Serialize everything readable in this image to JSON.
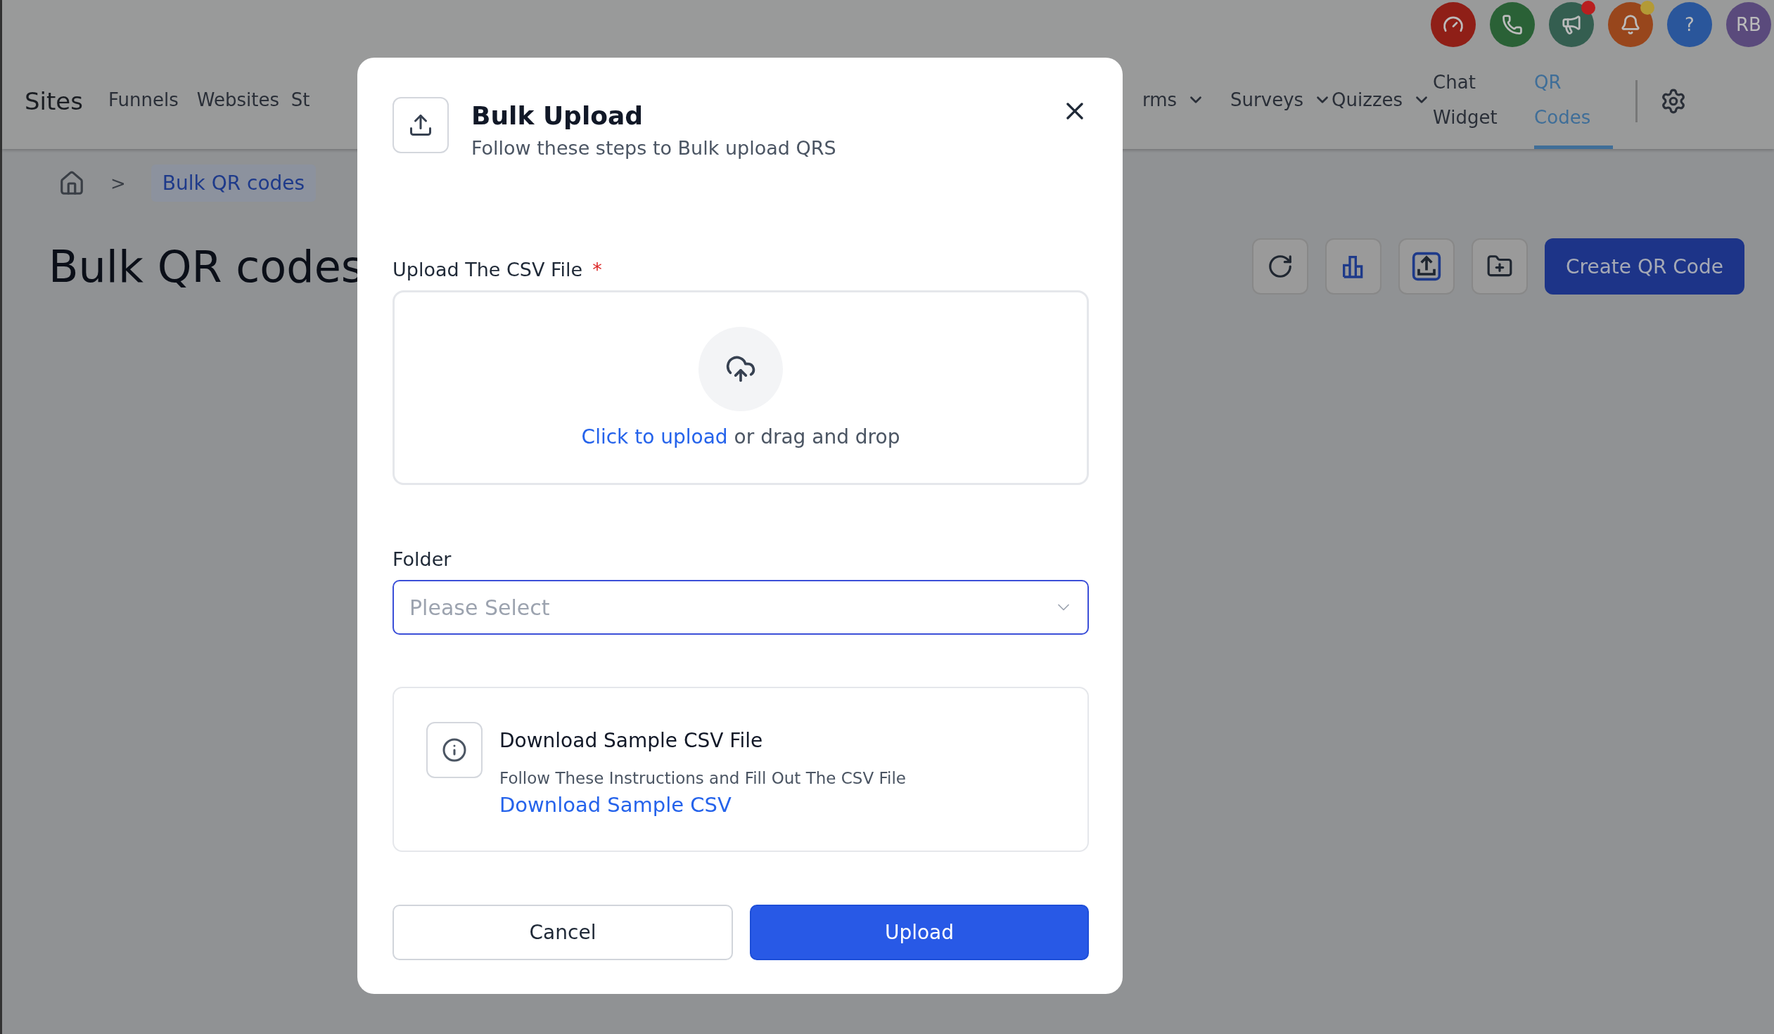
{
  "header_icons": [
    {
      "kind": "speedometer",
      "dot": false
    },
    {
      "kind": "phone",
      "dot": false
    },
    {
      "kind": "megaphone",
      "dot": true
    },
    {
      "kind": "bell",
      "dot": true
    },
    {
      "kind": "help",
      "label": "?",
      "dot": false
    },
    {
      "kind": "avatar",
      "label": "RB",
      "dot": false
    }
  ],
  "nav": {
    "brand": "Sites",
    "items_left": [
      {
        "label": "Funnels",
        "dropdown": false,
        "selected": false
      },
      {
        "label": "Websites",
        "dropdown": false,
        "selected": false
      },
      {
        "label": "St",
        "dropdown": false,
        "selected": false
      }
    ],
    "items_right": [
      {
        "label": "rms",
        "dropdown": true,
        "selected": false
      },
      {
        "label": "Surveys",
        "dropdown": true,
        "selected": false
      },
      {
        "label": "Quizzes",
        "dropdown": true,
        "selected": false
      },
      {
        "label": "Chat Widget",
        "dropdown": false,
        "selected": false
      },
      {
        "label": "QR Codes",
        "dropdown": false,
        "selected": true
      }
    ]
  },
  "breadcrumb": {
    "current": "Bulk QR codes",
    "separator": ">"
  },
  "page_title": "Bulk QR codes",
  "toolbar": [
    {
      "kind": "refresh"
    },
    {
      "kind": "chart"
    },
    {
      "kind": "upload"
    },
    {
      "kind": "folder"
    }
  ],
  "primary_button": "Create QR Code",
  "modal": {
    "title": "Bulk Upload",
    "subtitle": "Follow these steps to Bulk upload QRS",
    "upload_field": {
      "label": "Upload The CSV File",
      "required": true,
      "required_mark": "*",
      "link": "Click to upload",
      "rest": "or drag and drop"
    },
    "folder": {
      "label": "Folder",
      "placeholder": "Please Select"
    },
    "info": {
      "title": "Download Sample CSV File",
      "text": "Follow These Instructions and Fill Out The CSV File",
      "link": "Download Sample CSV"
    },
    "buttons": [
      {
        "kind": "secondary",
        "label": "Cancel"
      },
      {
        "kind": "primary",
        "label": "Upload"
      }
    ]
  }
}
